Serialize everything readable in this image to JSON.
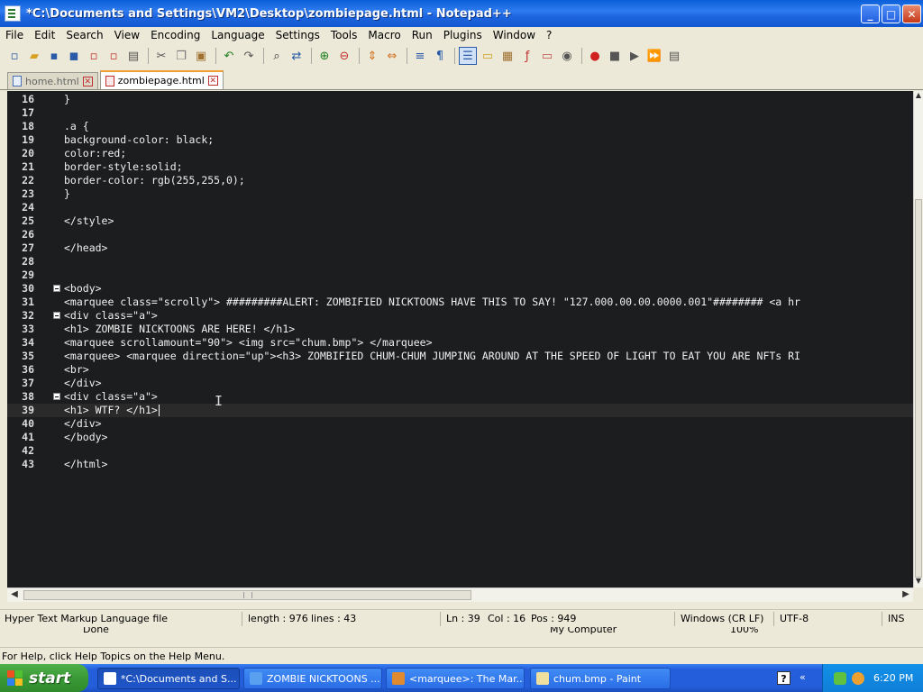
{
  "window": {
    "title": "*C:\\Documents and Settings\\VM2\\Desktop\\zombiepage.html - Notepad++"
  },
  "menu": [
    "File",
    "Edit",
    "Search",
    "View",
    "Encoding",
    "Language",
    "Settings",
    "Tools",
    "Macro",
    "Run",
    "Plugins",
    "Window",
    "?"
  ],
  "toolbar_icons": [
    "new-file-icon",
    "open-file-icon",
    "save-icon",
    "save-all-icon",
    "close-icon",
    "close-all-icon",
    "print-icon",
    "cut-icon",
    "copy-icon",
    "paste-icon",
    "undo-icon",
    "redo-icon",
    "find-icon",
    "replace-icon",
    "zoom-in-icon",
    "zoom-out-icon",
    "sync-vertical-icon",
    "sync-horizontal-icon",
    "word-wrap-icon",
    "show-all-chars-icon",
    "indent-guide-icon",
    "user-define-dialog-icon",
    "doc-map-icon",
    "function-list-icon",
    "folder-as-workspace-icon",
    "clipboard-history-icon",
    "monitoring-icon",
    "record-macro-icon",
    "stop-record-icon",
    "play-macro-icon",
    "run-multiple-macro-icon",
    "save-macro-icon"
  ],
  "tabs": [
    {
      "label": "home.html",
      "active": false
    },
    {
      "label": "zombiepage.html",
      "active": true
    }
  ],
  "editor": {
    "lines": [
      {
        "num": "16",
        "text": "}"
      },
      {
        "num": "17",
        "text": ""
      },
      {
        "num": "18",
        "text": ".a {"
      },
      {
        "num": "19",
        "text": "background-color: black;"
      },
      {
        "num": "20",
        "text": "color:red;"
      },
      {
        "num": "21",
        "text": "border-style:solid;"
      },
      {
        "num": "22",
        "text": "border-color: rgb(255,255,0);"
      },
      {
        "num": "23",
        "text": "}"
      },
      {
        "num": "24",
        "text": ""
      },
      {
        "num": "25",
        "text": "</style>"
      },
      {
        "num": "26",
        "text": ""
      },
      {
        "num": "27",
        "text": "</head>"
      },
      {
        "num": "28",
        "text": ""
      },
      {
        "num": "29",
        "text": ""
      },
      {
        "num": "30",
        "text": "<body>"
      },
      {
        "num": "31",
        "text": "<marquee class=\"scrolly\"> #########ALERT: ZOMBIFIED NICKTOONS HAVE THIS TO SAY! \"127.000.00.00.0000.001\"######## <a hr"
      },
      {
        "num": "32",
        "text": "<div class=\"a\">"
      },
      {
        "num": "33",
        "text": "<h1> ZOMBIE NICKTOONS ARE HERE! </h1>"
      },
      {
        "num": "34",
        "text": "<marquee scrollamount=\"90\"> <img src=\"chum.bmp\"> </marquee>"
      },
      {
        "num": "35",
        "text": "<marquee> <marquee direction=\"up\"><h3> ZOMBIFIED CHUM-CHUM JUMPING AROUND AT THE SPEED OF LIGHT TO EAT YOU ARE NFTs RI"
      },
      {
        "num": "36",
        "text": "<br>"
      },
      {
        "num": "37",
        "text": "</div>"
      },
      {
        "num": "38",
        "text": "<div class=\"a\">"
      },
      {
        "num": "39",
        "text": "<h1> WTF? </h1>"
      },
      {
        "num": "40",
        "text": "</div>"
      },
      {
        "num": "41",
        "text": "</body>"
      },
      {
        "num": "42",
        "text": ""
      },
      {
        "num": "43",
        "text": "</html>"
      }
    ],
    "fold_lines": [
      "30",
      "32",
      "38"
    ],
    "current_line": "39"
  },
  "status": {
    "file_type": "Hyper Text Markup Language file",
    "length": "length : 976",
    "lines": "lines : 43",
    "ln": "Ln : 39",
    "col": "Col : 16",
    "pos": "Pos : 949",
    "eol": "Windows (CR LF)",
    "encoding": "UTF-8",
    "mode": "INS"
  },
  "ie_status": {
    "done": "Done",
    "zone": "My Computer",
    "zoom": "100%"
  },
  "help_line": "For Help, click Help Topics on the Help Menu.",
  "taskbar": {
    "start": "start",
    "tasks": [
      {
        "label": "*C:\\Documents and S...",
        "active": true
      },
      {
        "label": "ZOMBIE NICKTOONS ...",
        "active": false
      },
      {
        "label": "<marquee>: The Mar...",
        "active": false
      },
      {
        "label": "chum.bmp - Paint",
        "active": false
      }
    ],
    "help_icon_text": "?",
    "chevron": "«",
    "clock": "6:20 PM"
  }
}
